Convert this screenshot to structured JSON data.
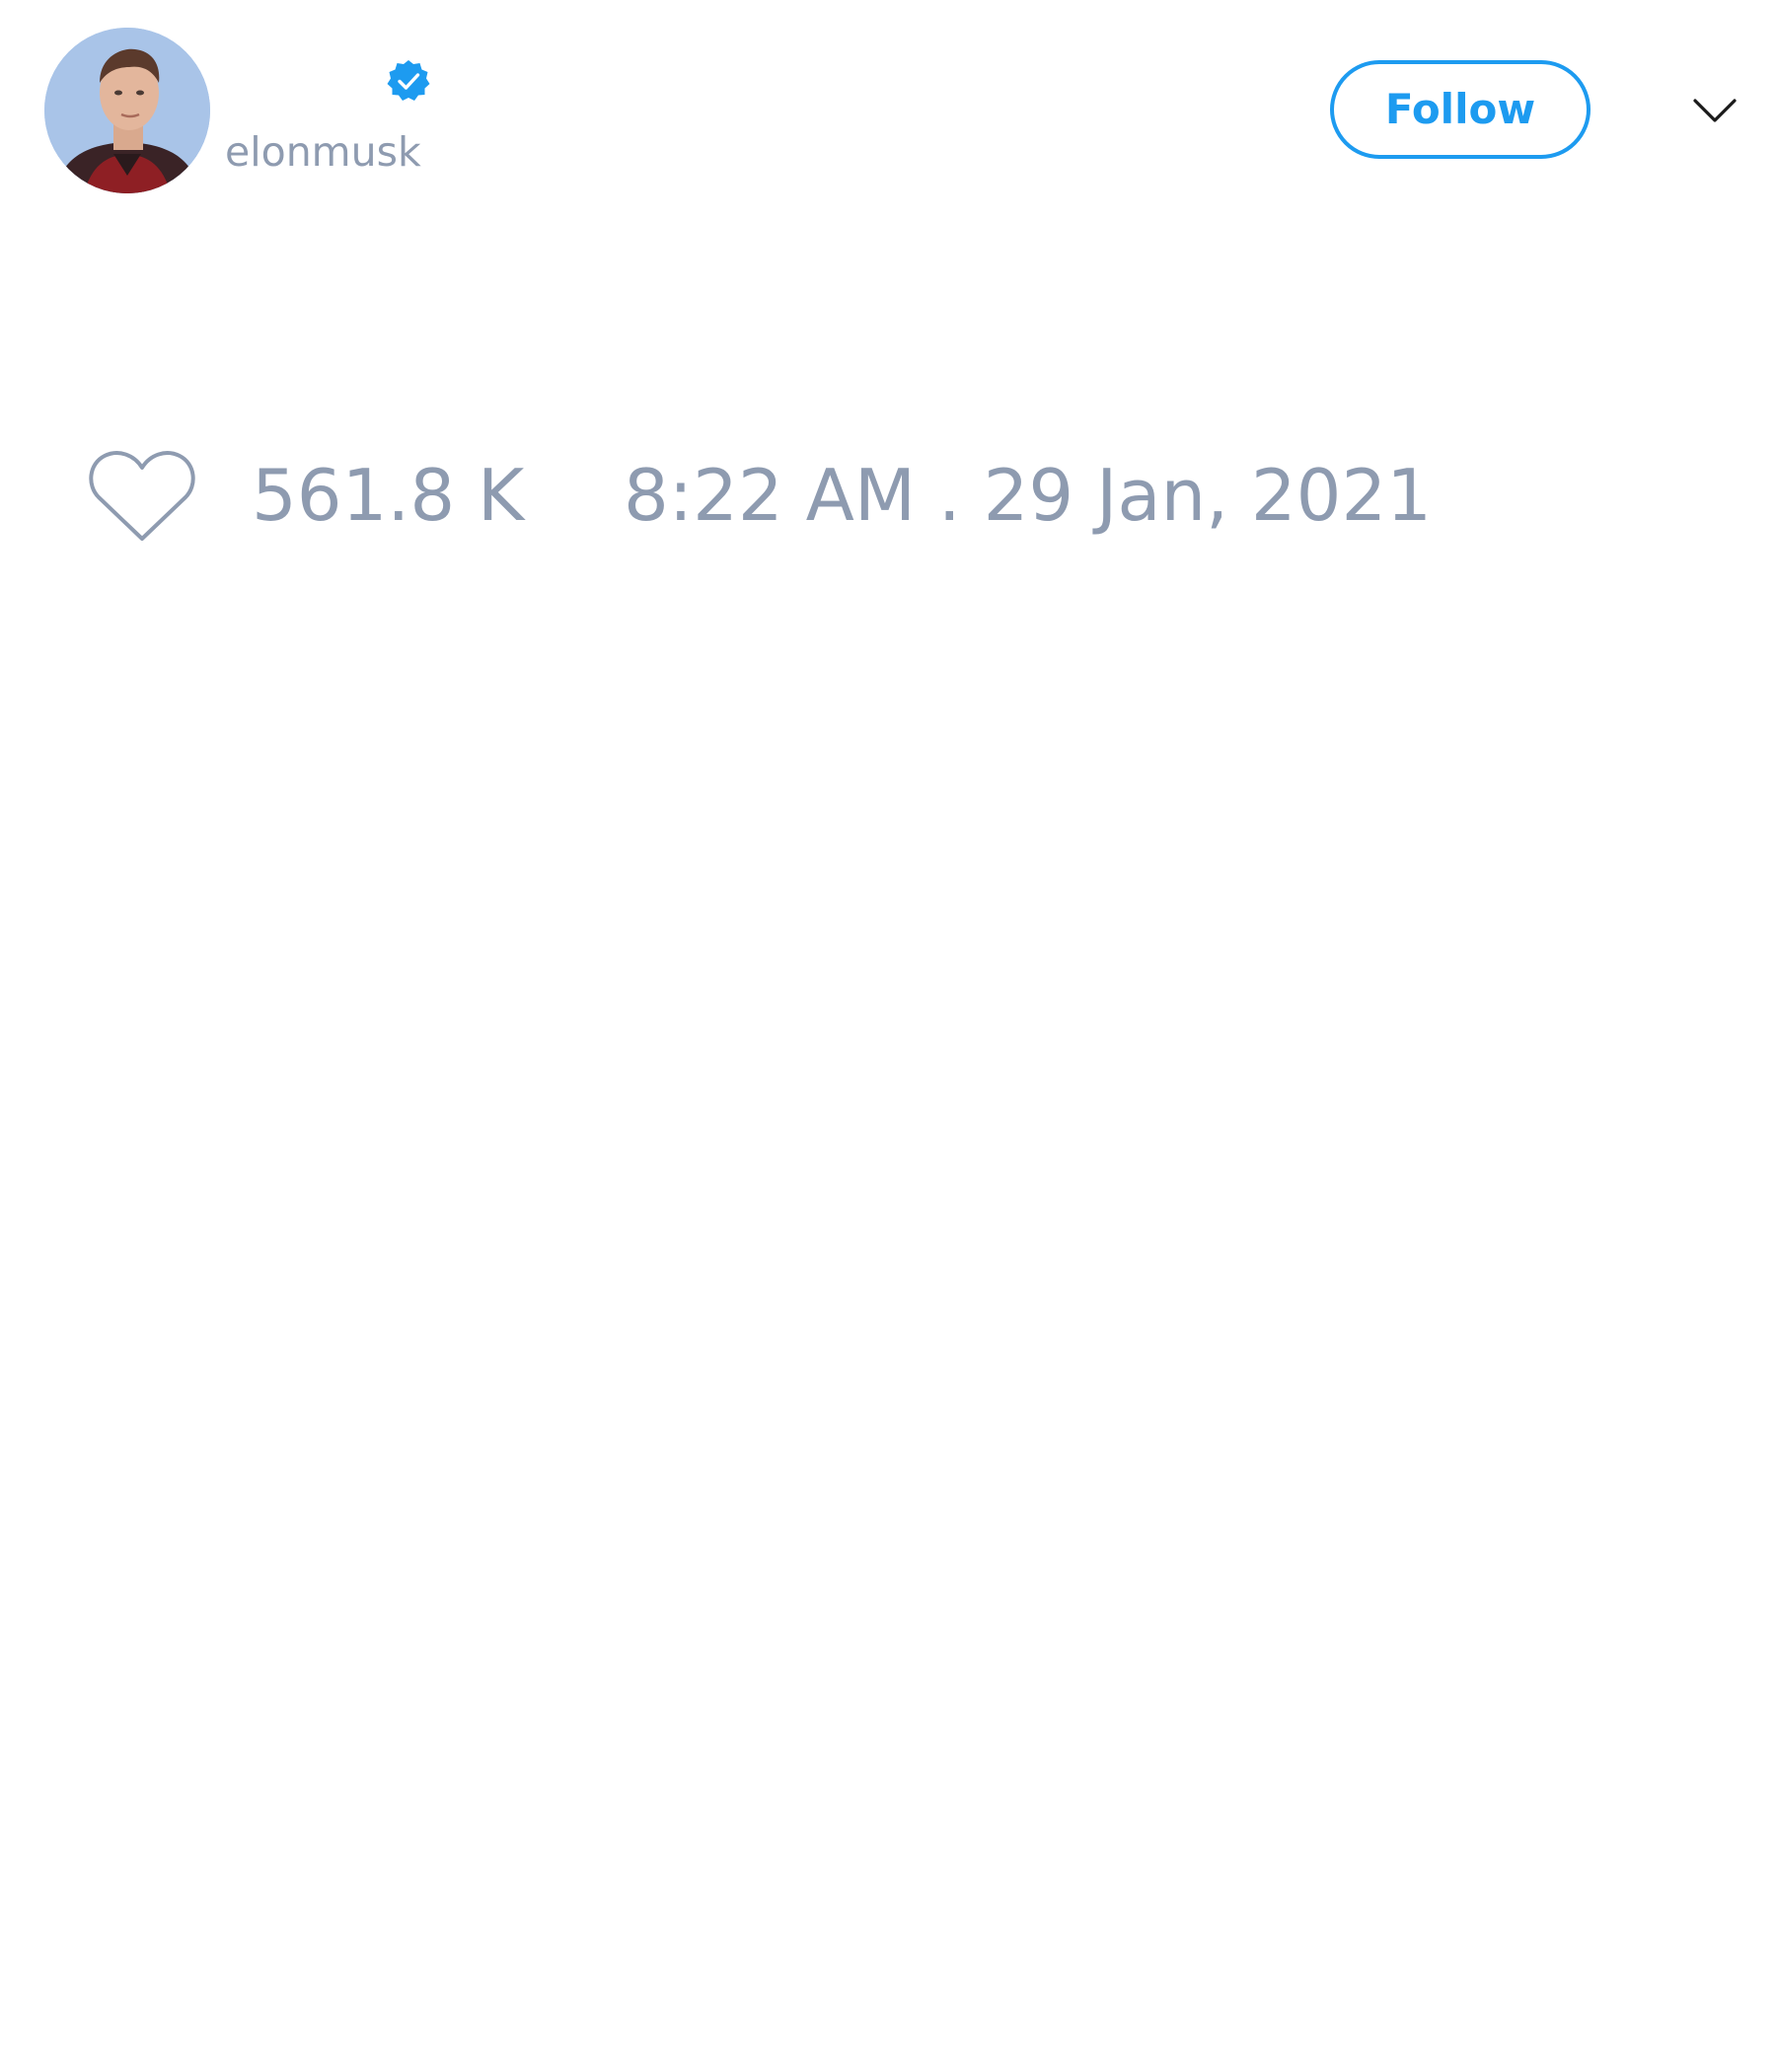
{
  "tweet": {
    "author": {
      "handle": "elonmusk",
      "verified": true,
      "avatar": "profile-photo"
    },
    "follow_button": {
      "label": "Follow"
    },
    "more_menu_icon": "chevron-down-icon",
    "likes": {
      "icon": "heart-outline-icon",
      "count": "561.8 K"
    },
    "timestamp": "8:22 AM . 29 Jan, 2021"
  },
  "colors": {
    "accent": "#1d9bf0",
    "muted_text": "#8e9bb0",
    "background": "#ffffff"
  }
}
